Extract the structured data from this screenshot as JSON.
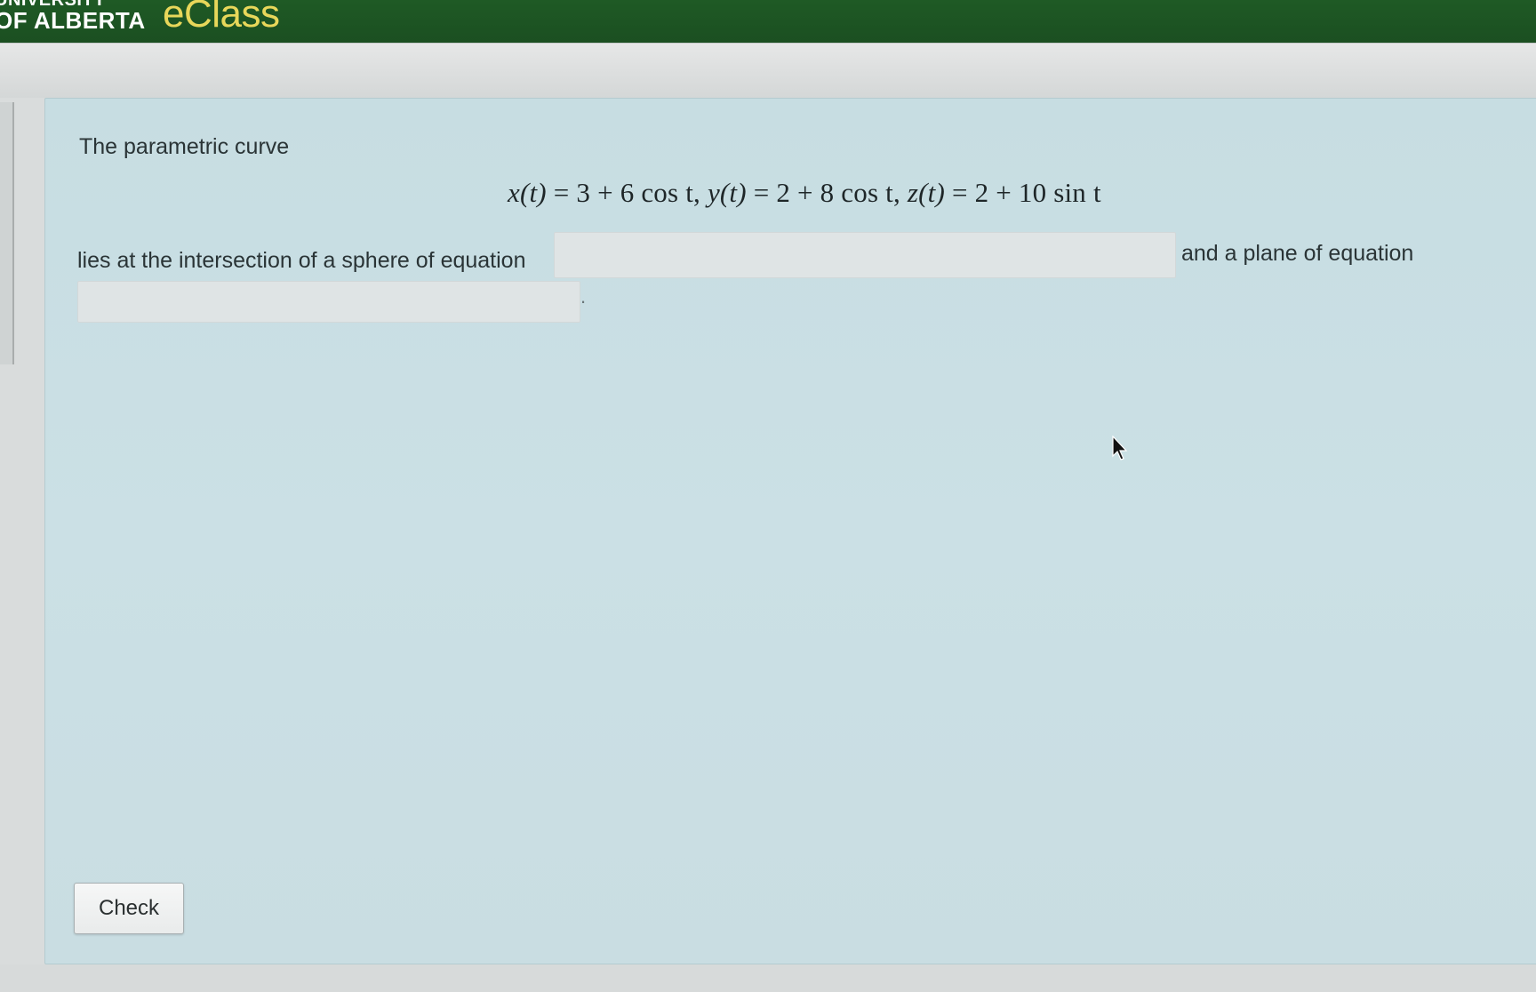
{
  "header": {
    "university_line1": "UNIVERSITY",
    "university_line2": "OF ALBERTA",
    "app_name": "eClass"
  },
  "question": {
    "intro": "The parametric curve",
    "equation_parts": {
      "x_lhs": "x(t)",
      "x_rhs": "= 3 + 6 cos t,",
      "y_lhs": "y(t)",
      "y_rhs": "= 2 + 8 cos t,",
      "z_lhs": "z(t)",
      "z_rhs": "= 2 + 10 sin t"
    },
    "sphere_label": "lies at the intersection of a sphere of equation",
    "sphere_value": "",
    "plane_label": "and a plane of equation",
    "plane_value": "",
    "period": "."
  },
  "actions": {
    "check_label": "Check"
  },
  "colors": {
    "brand_green": "#1f5a25",
    "brand_yellow": "#e8d75a",
    "card_background": "#c7dde2"
  }
}
